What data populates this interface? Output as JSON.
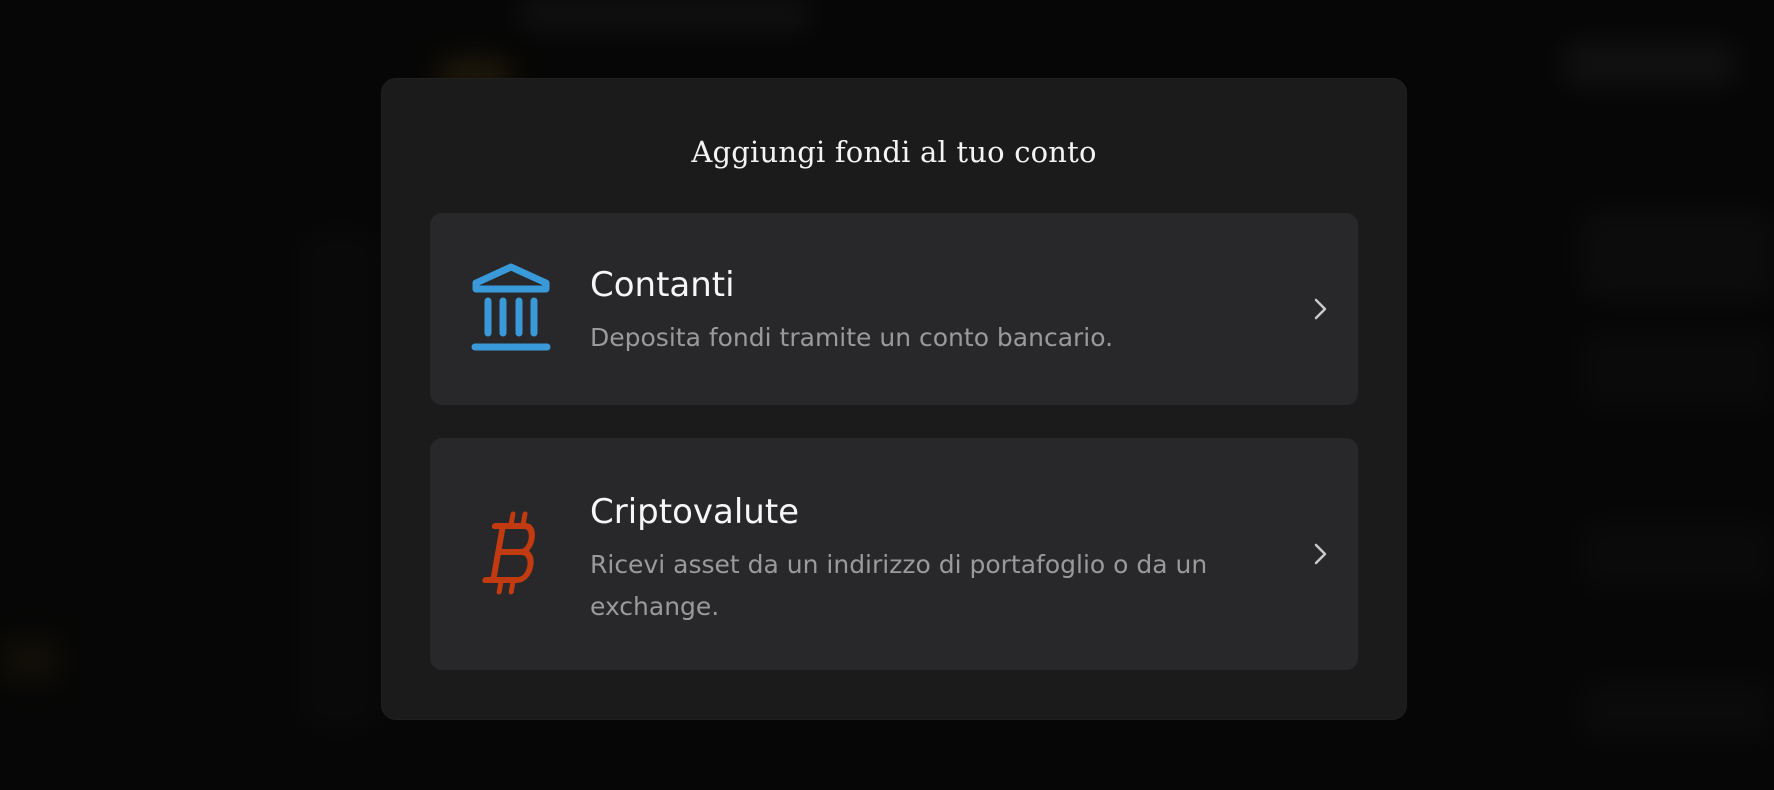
{
  "modal": {
    "title": "Aggiungi fondi al tuo conto",
    "options": [
      {
        "id": "cash",
        "title": "Contanti",
        "description": "Deposita fondi tramite un conto bancario.",
        "icon": "bank-icon",
        "icon_color": "#3a9ad9"
      },
      {
        "id": "crypto",
        "title": "Criptovalute",
        "description": "Ricevi asset da un indirizzo di portafoglio o da un exchange.",
        "icon": "bitcoin-icon",
        "icon_color": "#c23a0f"
      }
    ]
  },
  "colors": {
    "modal_bg": "#1b1b1c",
    "card_bg": "#28282a",
    "title_text": "#f4f4f4",
    "desc_text": "#9a9a9c"
  }
}
